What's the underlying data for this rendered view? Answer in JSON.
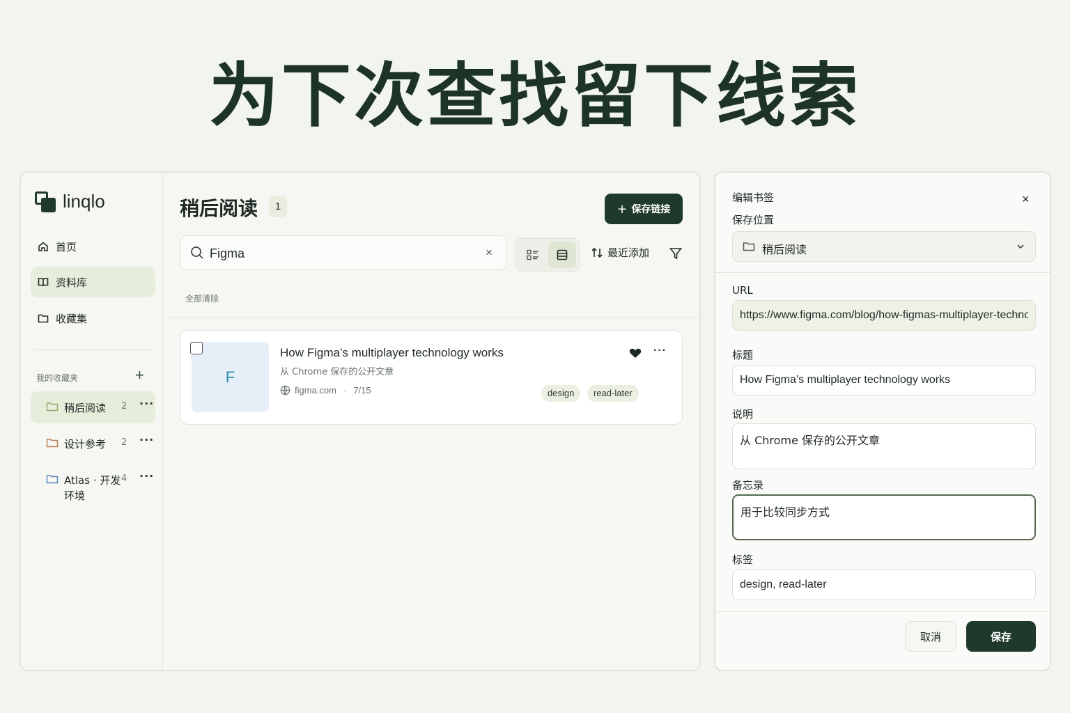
{
  "hero": {
    "headline": "为下次查找留下线索"
  },
  "sidebar": {
    "brand": "linqlo",
    "nav": [
      {
        "label": "首页",
        "icon": "home-icon"
      },
      {
        "label": "资料库",
        "icon": "book-icon",
        "active": true
      },
      {
        "label": "收藏集",
        "icon": "folder-icon"
      }
    ],
    "section_label": "我的收藏夹",
    "add_symbol": "+",
    "collections": [
      {
        "label": "稍后阅读",
        "count": "2",
        "active": true,
        "icon_color": "#9aa86f"
      },
      {
        "label": "设计参考",
        "count": "2",
        "icon_color": "#b98457"
      },
      {
        "label": "Atlas · 开发环境",
        "count": "4",
        "icon_color": "#5b86b8"
      }
    ],
    "more_symbol": "···"
  },
  "main": {
    "title": "稍后阅读",
    "title_count": "1",
    "save_link_label": "保存链接",
    "search": {
      "value": "Figma",
      "clear": "×"
    },
    "sort_label": "最近添加",
    "clear_all": "全部清除",
    "card": {
      "thumb_letter": "F",
      "title": "How Figma’s multiplayer technology works",
      "description": "从 Chrome 保存的公开文章",
      "domain": "figma.com",
      "separator": "·",
      "date": "7/15",
      "tags": [
        "design",
        "read-later"
      ],
      "more": "···"
    }
  },
  "panel": {
    "title": "编辑书签",
    "close": "×",
    "location_label": "保存位置",
    "location_value": "稍后阅读",
    "url_label": "URL",
    "url_value": "https://www.figma.com/blog/how-figmas-multiplayer-technology-works/",
    "title_label": "标题",
    "title_value": "How Figma’s multiplayer technology works",
    "desc_label": "说明",
    "desc_value": "从 Chrome 保存的公开文章",
    "note_label": "备忘录",
    "note_value": "用于比较同步方式",
    "tags_label": "标签",
    "tags_value": "design, read-later",
    "cancel_label": "取消",
    "save_label": "保存"
  },
  "colors": {
    "accent": "#1f3a2c",
    "active_bg": "#e5eddb",
    "background": "#f2f4ef"
  }
}
